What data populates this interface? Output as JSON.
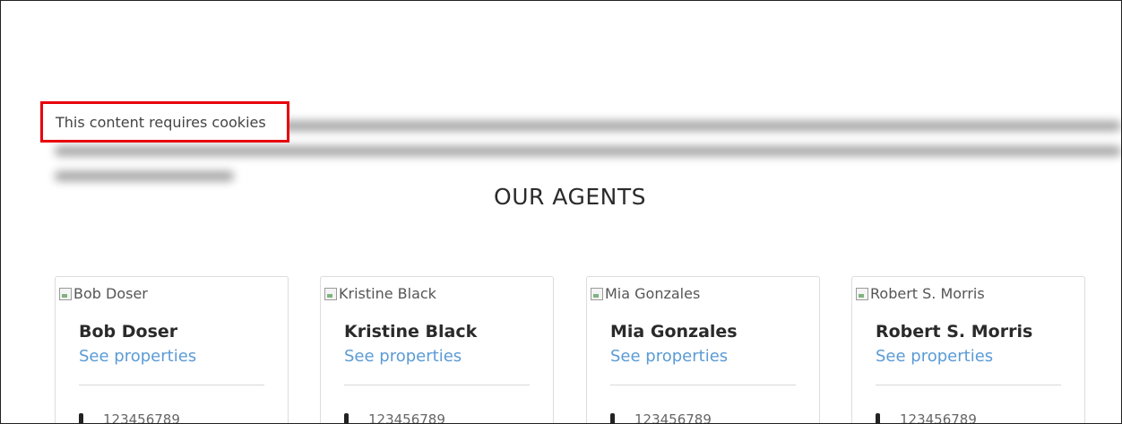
{
  "cookie_notice": {
    "text": "This content requires cookies"
  },
  "agents_section": {
    "title": "OUR AGENTS",
    "agents": [
      {
        "image_alt": "Bob Doser",
        "name": "Bob Doser",
        "link_label": "See properties",
        "phone": "123456789"
      },
      {
        "image_alt": "Kristine Black",
        "name": "Kristine Black",
        "link_label": "See properties",
        "phone": "123456789"
      },
      {
        "image_alt": "Mia Gonzales",
        "name": "Mia Gonzales",
        "link_label": "See properties",
        "phone": "123456789"
      },
      {
        "image_alt": "Robert S. Morris",
        "name": "Robert S. Morris",
        "link_label": "See properties",
        "phone": "123456789"
      }
    ]
  },
  "colors": {
    "highlight_border": "#e8000b",
    "link": "#5b9bd5"
  },
  "icons": {
    "broken_image": "broken-image-icon",
    "phone": "phone-icon"
  }
}
